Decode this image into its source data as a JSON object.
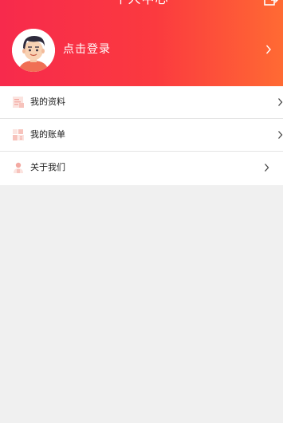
{
  "header": {
    "title": "个人中心",
    "action_icon": "exit-icon",
    "gradient": [
      "#f72a4c",
      "#ff6a33"
    ]
  },
  "profile": {
    "login_label": "点击登录",
    "avatar_icon": "cartoon-avatar-icon"
  },
  "menu": {
    "items": [
      {
        "label": "我的资料",
        "icon": "profile-doc-icon"
      },
      {
        "label": "我的账单",
        "icon": "bill-icon"
      },
      {
        "label": "关于我们",
        "icon": "about-icon"
      }
    ]
  },
  "colors": {
    "accent": "#f72a4c",
    "page_background": "#f0f0f0",
    "icon_tint": "#f3a9a2"
  }
}
